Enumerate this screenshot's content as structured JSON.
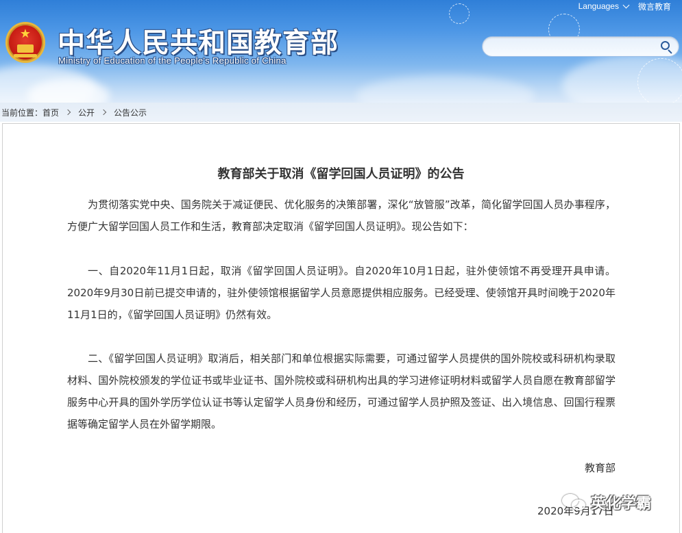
{
  "header": {
    "title": "中华人民共和国教育部",
    "subtitle": "Ministry of Education of the People's Republic of China",
    "languages_label": "Languages",
    "weiyan_label": "微言教育",
    "search_placeholder": ""
  },
  "breadcrumb": {
    "label": "当前位置：",
    "items": [
      "首页",
      "公开",
      "公告公示"
    ]
  },
  "article": {
    "title": "教育部关于取消《留学回国人员证明》的公告",
    "paragraphs": [
      "为贯彻落实党中央、国务院关于减证便民、优化服务的决策部署，深化“放管服”改革，简化留学回国人员办事程序，方便广大留学回国人员工作和生活，教育部决定取消《留学回国人员证明》。现公告如下：",
      "一、自2020年11月1日起，取消《留学回国人员证明》。自2020年10月1日起，驻外使领馆不再受理开具申请。2020年9月30日前已提交申请的，驻外使领馆根据留学人员意愿提供相应服务。已经受理、使领馆开具时间晚于2020年11月1日的，《留学回国人员证明》仍然有效。",
      "二、《留学回国人员证明》取消后，相关部门和单位根据实际需要，可通过留学人员提供的国外院校或科研机构录取材料、国外院校颁发的学位证书或毕业证书、国外院校或科研机构出具的学习进修证明材料或留学人员自愿在教育部留学服务中心开具的国外学历学位认证书等认定留学人员身份和经历，可通过留学人员护照及签证、出入境信息、回国行程票据等确定留学人员在外留学期限。"
    ],
    "signature": "教育部",
    "date": "2020年9月17日"
  },
  "watermark": {
    "text": "英化学霸",
    "icon": "wechat-icon"
  },
  "colors": {
    "header_blue": "#2f7fd8",
    "text": "#333333",
    "border": "#cfcfcf"
  }
}
